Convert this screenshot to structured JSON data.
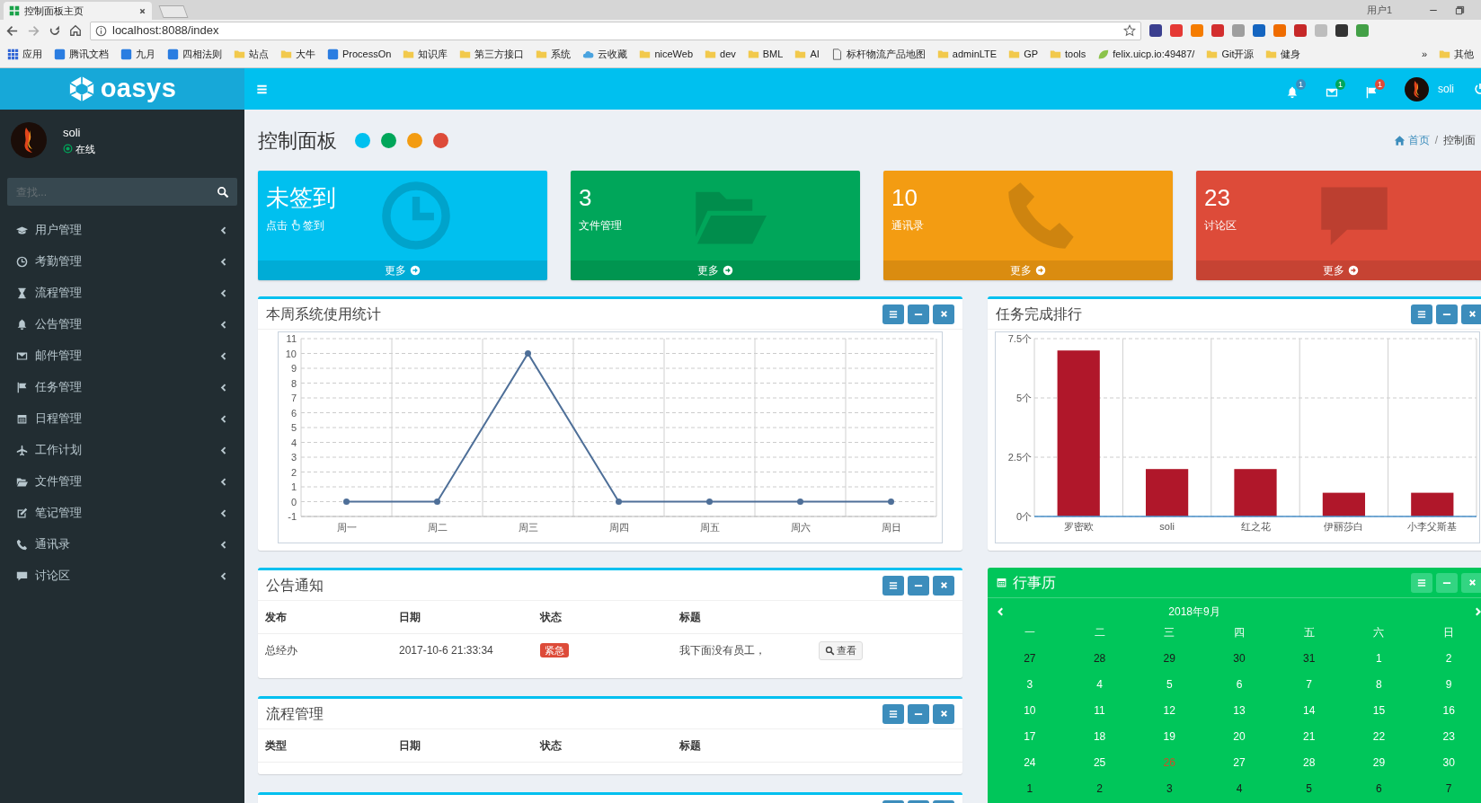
{
  "browser": {
    "tab": {
      "title": "控制面板主页"
    },
    "user": "用户1",
    "url": "localhost:8088/index",
    "bookmarks": [
      {
        "label": "应用",
        "kind": "apps"
      },
      {
        "label": "腾讯文档",
        "kind": "site"
      },
      {
        "label": "九月",
        "kind": "site"
      },
      {
        "label": "四相法则",
        "kind": "site"
      },
      {
        "label": "站点",
        "kind": "folder"
      },
      {
        "label": "大牛",
        "kind": "folder"
      },
      {
        "label": "ProcessOn",
        "kind": "site"
      },
      {
        "label": "知识库",
        "kind": "folder"
      },
      {
        "label": "第三方接口",
        "kind": "folder"
      },
      {
        "label": "系统",
        "kind": "folder"
      },
      {
        "label": "云收藏",
        "kind": "cloud"
      },
      {
        "label": "niceWeb",
        "kind": "folder"
      },
      {
        "label": "dev",
        "kind": "folder"
      },
      {
        "label": "BML",
        "kind": "folder"
      },
      {
        "label": "AI",
        "kind": "folder"
      },
      {
        "label": "标杆物流产品地图",
        "kind": "page"
      },
      {
        "label": "adminLTE",
        "kind": "folder"
      },
      {
        "label": "GP",
        "kind": "folder"
      },
      {
        "label": "tools",
        "kind": "folder"
      },
      {
        "label": "felix.uicp.io:49487/",
        "kind": "leaf"
      },
      {
        "label": "Git开源",
        "kind": "folder"
      },
      {
        "label": "健身",
        "kind": "folder"
      }
    ],
    "more": "»",
    "other": "其他"
  },
  "app": {
    "logo": "oasys",
    "header_user": "soli",
    "sidebar_user": {
      "name": "soli",
      "status": "在线"
    },
    "search": {
      "placeholder": "查找..."
    },
    "notifications": [
      {
        "kind": "bell",
        "count": "1",
        "color": "#3c8dbc"
      },
      {
        "kind": "envelope",
        "count": "1",
        "color": "#00a65a"
      },
      {
        "kind": "flag",
        "count": "1",
        "color": "#dd4b39"
      }
    ],
    "sidebar": {
      "items": [
        {
          "label": "用户管理",
          "kind": "graduation"
        },
        {
          "label": "考勤管理",
          "kind": "clock"
        },
        {
          "label": "流程管理",
          "kind": "hourglass"
        },
        {
          "label": "公告管理",
          "kind": "bell"
        },
        {
          "label": "邮件管理",
          "kind": "envelope"
        },
        {
          "label": "任务管理",
          "kind": "flag"
        },
        {
          "label": "日程管理",
          "kind": "calendar"
        },
        {
          "label": "工作计划",
          "kind": "plane"
        },
        {
          "label": "文件管理",
          "kind": "folder"
        },
        {
          "label": "笔记管理",
          "kind": "edit"
        },
        {
          "label": "通讯录",
          "kind": "phone"
        },
        {
          "label": "讨论区",
          "kind": "comment"
        }
      ]
    }
  },
  "page": {
    "title": "控制面板",
    "theme_dots": [
      {
        "color": "#00c0ef"
      },
      {
        "color": "#00a65a"
      },
      {
        "color": "#f39c12"
      },
      {
        "color": "#dd4b39"
      }
    ],
    "breadcrumb": {
      "separator": "/",
      "items": [
        {
          "label": "首页",
          "kind": "home"
        },
        {
          "label": "控制面",
          "kind": "plain"
        }
      ]
    }
  },
  "info_boxes": [
    {
      "value": "未签到",
      "label": "点击",
      "label_suffix": "签到",
      "kind": "clock",
      "color": "#00c0ef",
      "footer": "更多"
    },
    {
      "value": "3",
      "label": "文件管理",
      "kind": "folder",
      "color": "#00a65a",
      "footer": "更多"
    },
    {
      "value": "10",
      "label": "通讯录",
      "kind": "phone",
      "color": "#f39c12",
      "footer": "更多"
    },
    {
      "value": "23",
      "label": "讨论区",
      "kind": "comment",
      "color": "#dd4b39",
      "footer": "更多"
    }
  ],
  "usage_panel": {
    "title": "本周系统使用统计",
    "chart_data": {
      "type": "line",
      "categories": [
        "周一",
        "周二",
        "周三",
        "周四",
        "周五",
        "周六",
        "周日"
      ],
      "series": [
        {
          "color": "#4e6f98",
          "marker": "circle",
          "values": [
            0,
            0,
            10,
            0,
            0,
            0,
            0
          ]
        }
      ],
      "grid": true,
      "ylim": [
        -1,
        11
      ],
      "yticks": [
        -1,
        0,
        1,
        2,
        3,
        4,
        5,
        6,
        7,
        8,
        9,
        10,
        11
      ]
    }
  },
  "ranking_panel": {
    "title": "任务完成排行",
    "chart_data": {
      "type": "bar",
      "categories": [
        "罗密欧",
        "soli",
        "红之花",
        "伊丽莎白",
        "小李父斯基"
      ],
      "series": [
        {
          "color": "#b0172a",
          "values": [
            7,
            2,
            2,
            1,
            1
          ]
        }
      ],
      "grid": true,
      "ylim": [
        0,
        7.5
      ],
      "yticks": [
        {
          "value": 0,
          "label": "0个"
        },
        {
          "value": 2.5,
          "label": "2.5个"
        },
        {
          "value": 5,
          "label": "5个"
        },
        {
          "value": 7.5,
          "label": "7.5个"
        }
      ]
    }
  },
  "notice_panel": {
    "title": "公告通知",
    "columns": [
      "发布",
      "日期",
      "状态",
      "标题"
    ],
    "rows": [
      {
        "publisher": "总经办",
        "date": "2017-10-6 21:33:34",
        "status": "紧急",
        "color": "#dd4b39",
        "title": "我下面没有员工，",
        "action": "查看"
      }
    ]
  },
  "process_panel": {
    "title": "流程管理",
    "columns": [
      "类型",
      "日期",
      "状态",
      "标题"
    ]
  },
  "calendar": {
    "title": "行事历",
    "month": "2018年9月",
    "weekdays": [
      "一",
      "二",
      "三",
      "四",
      "五",
      "六",
      "日"
    ],
    "weeks": [
      [
        {
          "day": "27",
          "kind": "other"
        },
        {
          "day": "28",
          "kind": "other"
        },
        {
          "day": "29",
          "kind": "other"
        },
        {
          "day": "30",
          "kind": "other"
        },
        {
          "day": "31",
          "kind": "other"
        },
        {
          "day": "1",
          "kind": "day"
        },
        {
          "day": "2",
          "kind": "day"
        }
      ],
      [
        {
          "day": "3",
          "kind": "day"
        },
        {
          "day": "4",
          "kind": "day"
        },
        {
          "day": "5",
          "kind": "day"
        },
        {
          "day": "6",
          "kind": "day"
        },
        {
          "day": "7",
          "kind": "day"
        },
        {
          "day": "8",
          "kind": "day"
        },
        {
          "day": "9",
          "kind": "day"
        }
      ],
      [
        {
          "day": "10",
          "kind": "day"
        },
        {
          "day": "11",
          "kind": "day"
        },
        {
          "day": "12",
          "kind": "day"
        },
        {
          "day": "13",
          "kind": "day"
        },
        {
          "day": "14",
          "kind": "day"
        },
        {
          "day": "15",
          "kind": "day"
        },
        {
          "day": "16",
          "kind": "day"
        }
      ],
      [
        {
          "day": "17",
          "kind": "day"
        },
        {
          "day": "18",
          "kind": "day"
        },
        {
          "day": "19",
          "kind": "day"
        },
        {
          "day": "20",
          "kind": "day"
        },
        {
          "day": "21",
          "kind": "day"
        },
        {
          "day": "22",
          "kind": "day"
        },
        {
          "day": "23",
          "kind": "day"
        }
      ],
      [
        {
          "day": "24",
          "kind": "day"
        },
        {
          "day": "25",
          "kind": "day"
        },
        {
          "day": "26",
          "kind": "today"
        },
        {
          "day": "27",
          "kind": "day"
        },
        {
          "day": "28",
          "kind": "day"
        },
        {
          "day": "29",
          "kind": "day"
        },
        {
          "day": "30",
          "kind": "day"
        }
      ],
      [
        {
          "day": "1",
          "kind": "other"
        },
        {
          "day": "2",
          "kind": "other"
        },
        {
          "day": "3",
          "kind": "other"
        },
        {
          "day": "4",
          "kind": "other"
        },
        {
          "day": "5",
          "kind": "other"
        },
        {
          "day": "6",
          "kind": "other"
        },
        {
          "day": "7",
          "kind": "other"
        }
      ]
    ]
  }
}
